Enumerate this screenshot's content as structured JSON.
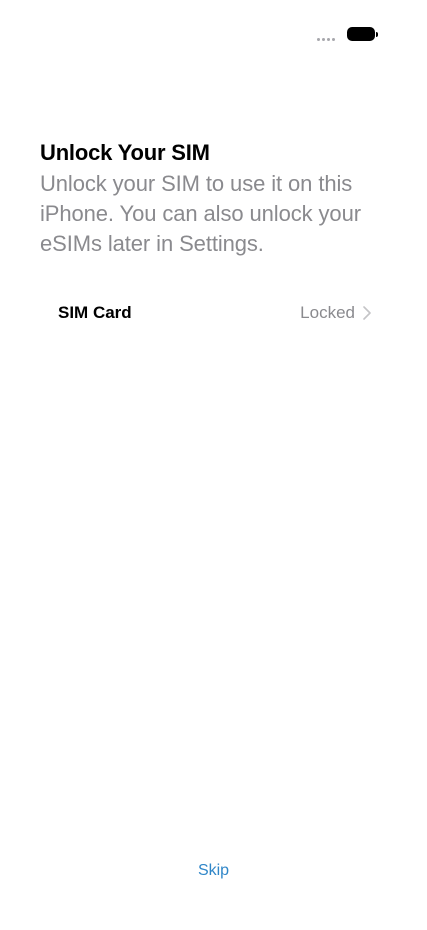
{
  "header": {
    "title": "Unlock Your SIM",
    "subtitle": "Unlock your SIM to use it on this iPhone. You can also unlock your eSIMs later in Settings."
  },
  "sim_row": {
    "label": "SIM Card",
    "status": "Locked",
    "chevron_icon": "chevron-right-icon"
  },
  "footer": {
    "skip_label": "Skip"
  },
  "status_bar": {
    "signal_icon": "signal-dots-icon",
    "battery_icon": "battery-icon"
  },
  "colors": {
    "link": "#2f86c8",
    "secondary_text": "#8a8a8e"
  }
}
